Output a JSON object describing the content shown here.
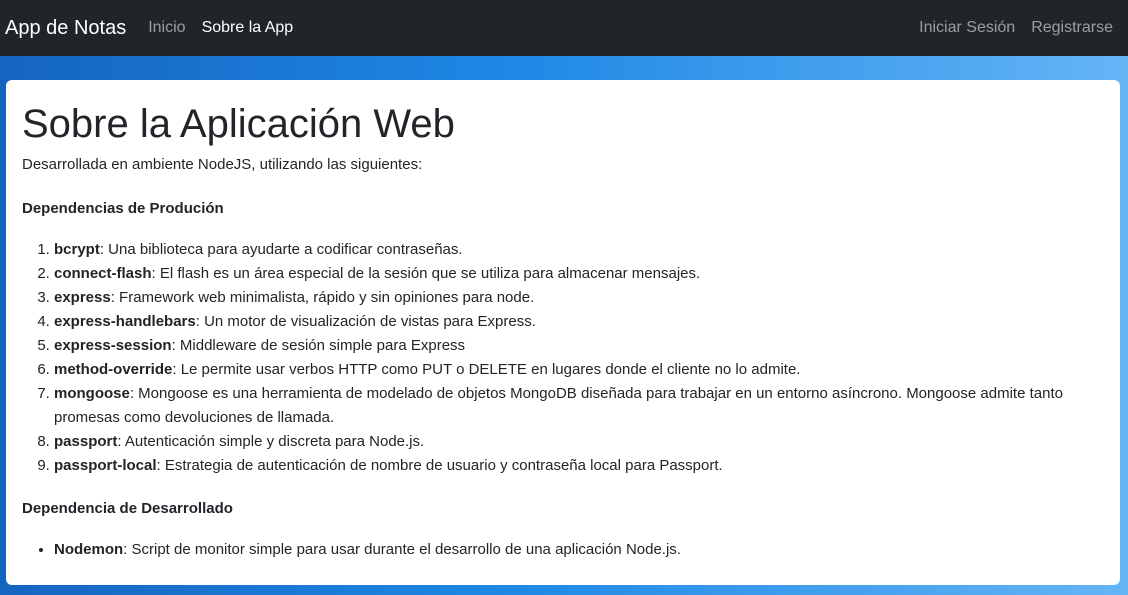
{
  "navbar": {
    "brand": "App de Notas",
    "links": [
      {
        "label": "Inicio"
      },
      {
        "label": "Sobre la App"
      }
    ],
    "right_links": [
      {
        "label": "Iniciar Sesión"
      },
      {
        "label": "Registrarse"
      }
    ]
  },
  "main": {
    "title": "Sobre la Aplicación Web",
    "intro": "Desarrollada en ambiente NodeJS, utilizando las siguientes:",
    "prod_heading": "Dependencias de Produción",
    "prod_deps": [
      {
        "name": "bcrypt",
        "desc": ": Una biblioteca para ayudarte a codificar contraseñas."
      },
      {
        "name": "connect-flash",
        "desc": ": El flash es un área especial de la sesión que se utiliza para almacenar mensajes."
      },
      {
        "name": "express",
        "desc": ": Framework web minimalista, rápido y sin opiniones para node."
      },
      {
        "name": "express-handlebars",
        "desc": ": Un motor de visualización de vistas para Express."
      },
      {
        "name": "express-session",
        "desc": ": Middleware de sesión simple para Express"
      },
      {
        "name": "method-override",
        "desc": ": Le permite usar verbos HTTP como PUT o DELETE en lugares donde el cliente no lo admite."
      },
      {
        "name": "mongoose",
        "desc": ": Mongoose es una herramienta de modelado de objetos MongoDB diseñada para trabajar en un entorno asíncrono. Mongoose admite tanto promesas como devoluciones de llamada."
      },
      {
        "name": "passport",
        "desc": ": Autenticación simple y discreta para Node.js."
      },
      {
        "name": "passport-local",
        "desc": ": Estrategia de autenticación de nombre de usuario y contraseña local para Passport."
      }
    ],
    "dev_heading": "Dependencia de Desarrollado",
    "dev_deps": [
      {
        "name": "Nodemon",
        "desc": ": Script de monitor simple para usar durante el desarrollo de una aplicación Node.js."
      }
    ]
  }
}
